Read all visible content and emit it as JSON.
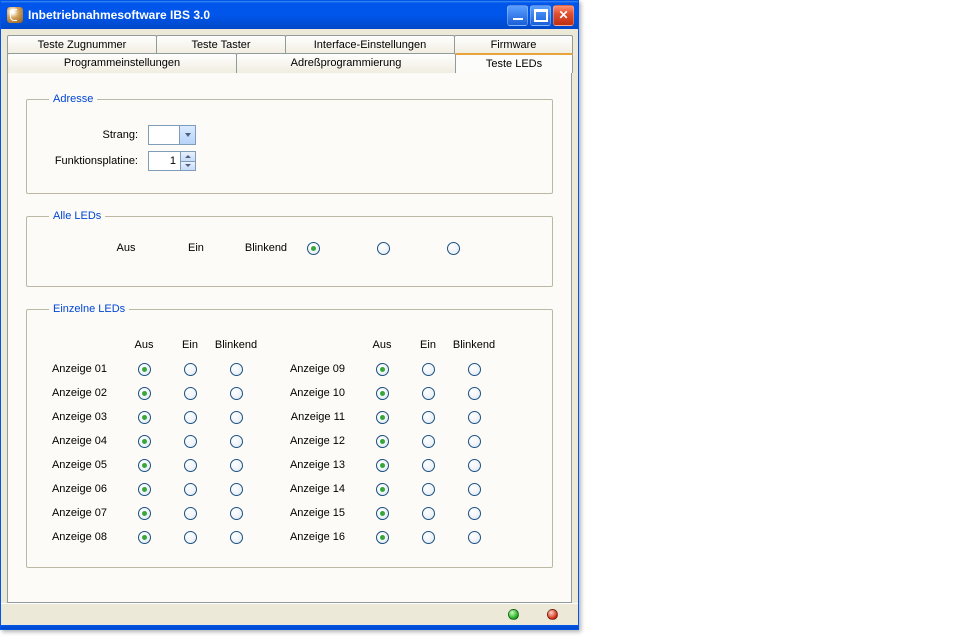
{
  "window": {
    "title": "Inbetriebnahmesoftware IBS 3.0"
  },
  "tabs": {
    "row1": [
      {
        "label": "Teste Zugnummer"
      },
      {
        "label": "Teste Taster"
      },
      {
        "label": "Interface-Einstellungen"
      },
      {
        "label": "Firmware"
      }
    ],
    "row2": [
      {
        "label": "Programmeinstellungen"
      },
      {
        "label": "Adreßprogrammierung"
      },
      {
        "label": "Teste LEDs"
      }
    ],
    "active": "Teste LEDs"
  },
  "groups": {
    "adresse": {
      "legend": "Adresse",
      "strang_label": "Strang:",
      "strang_value": "",
      "funktionsplatine_label": "Funktionsplatine:",
      "funktionsplatine_value": "1"
    },
    "alle_leds": {
      "legend": "Alle LEDs",
      "headers": {
        "aus": "Aus",
        "ein": "Ein",
        "blinkend": "Blinkend"
      },
      "selected": "aus"
    },
    "einzelne": {
      "legend": "Einzelne LEDs",
      "headers": {
        "aus": "Aus",
        "ein": "Ein",
        "blinkend": "Blinkend"
      },
      "left": [
        {
          "label": "Anzeige 01",
          "selected": "aus"
        },
        {
          "label": "Anzeige 02",
          "selected": "aus"
        },
        {
          "label": "Anzeige 03",
          "selected": "aus"
        },
        {
          "label": "Anzeige 04",
          "selected": "aus"
        },
        {
          "label": "Anzeige 05",
          "selected": "aus"
        },
        {
          "label": "Anzeige 06",
          "selected": "aus"
        },
        {
          "label": "Anzeige 07",
          "selected": "aus"
        },
        {
          "label": "Anzeige 08",
          "selected": "aus"
        }
      ],
      "right": [
        {
          "label": "Anzeige 09",
          "selected": "aus"
        },
        {
          "label": "Anzeige 10",
          "selected": "aus"
        },
        {
          "label": "Anzeige 11",
          "selected": "aus"
        },
        {
          "label": "Anzeige 12",
          "selected": "aus"
        },
        {
          "label": "Anzeige 13",
          "selected": "aus"
        },
        {
          "label": "Anzeige 14",
          "selected": "aus"
        },
        {
          "label": "Anzeige 15",
          "selected": "aus"
        },
        {
          "label": "Anzeige 16",
          "selected": "aus"
        }
      ]
    }
  },
  "status": {
    "dot1": "green",
    "dot2": "red"
  }
}
